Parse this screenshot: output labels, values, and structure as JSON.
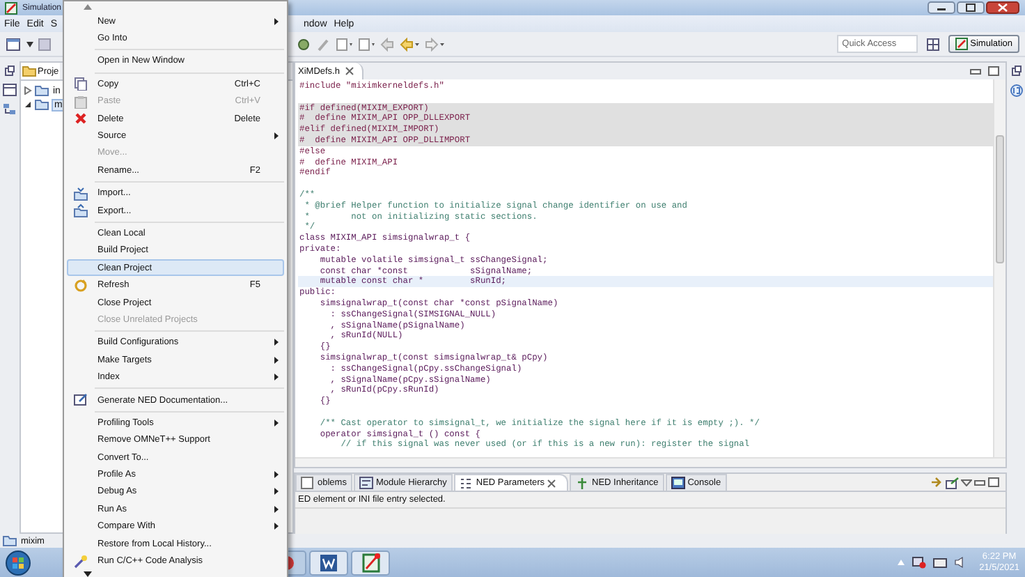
{
  "window": {
    "title": "Simulation"
  },
  "menu_bar": [
    "File",
    "Edit",
    "S",
    "ndow",
    "Help"
  ],
  "quick_access": {
    "placeholder": "Quick Access"
  },
  "perspective_button": {
    "label": "Simulation",
    "selected": true
  },
  "project_explorer": {
    "tab": "Proje",
    "items": [
      {
        "label": "in",
        "expanded": false
      },
      {
        "label": "m",
        "expanded": true
      }
    ]
  },
  "editor": {
    "tab": "XiMDefs.h",
    "lines": [
      {
        "kind": "preproc",
        "text": "#include \"miximkerneldefs.h\"",
        "shaded": false,
        "current": false
      },
      {
        "kind": "blank",
        "shaded": false,
        "current": false
      },
      {
        "kind": "preproc",
        "text": "#if defined(MIXIM_EXPORT)",
        "shaded": true,
        "current": false
      },
      {
        "kind": "preproc",
        "text": "#  define MIXIM_API OPP_DLLEXPORT",
        "shaded": true,
        "current": false
      },
      {
        "kind": "preproc",
        "text": "#elif defined(MIXIM_IMPORT)",
        "shaded": true,
        "current": false
      },
      {
        "kind": "preproc",
        "text": "#  define MIXIM_API OPP_DLLIMPORT",
        "shaded": true,
        "current": false
      },
      {
        "kind": "preproc",
        "text": "#else",
        "shaded": false,
        "current": false
      },
      {
        "kind": "preproc",
        "text": "#  define MIXIM_API",
        "shaded": false,
        "current": false
      },
      {
        "kind": "preproc",
        "text": "#endif",
        "shaded": false,
        "current": false
      },
      {
        "kind": "blank",
        "shaded": false,
        "current": false
      },
      {
        "kind": "comment",
        "text": "/**",
        "shaded": false,
        "current": false
      },
      {
        "kind": "comment",
        "text": " * @brief Helper function to initialize signal change identifier on use and",
        "shaded": false,
        "current": false
      },
      {
        "kind": "comment",
        "text": " *        not on initializing static sections.",
        "shaded": false,
        "current": false
      },
      {
        "kind": "comment",
        "text": " */",
        "shaded": false,
        "current": false
      },
      {
        "kind": "code",
        "text": "class MIXIM_API simsignalwrap_t {",
        "shaded": false,
        "current": false
      },
      {
        "kind": "code",
        "text": "private:",
        "shaded": false,
        "current": false
      },
      {
        "kind": "code",
        "text": "    mutable volatile simsignal_t ssChangeSignal;",
        "shaded": false,
        "current": false
      },
      {
        "kind": "code",
        "text": "    const char *const            sSignalName;",
        "shaded": false,
        "current": false
      },
      {
        "kind": "code",
        "text": "    mutable const char *         sRunId;",
        "shaded": false,
        "current": true
      },
      {
        "kind": "code",
        "text": "public:",
        "shaded": false,
        "current": false
      },
      {
        "kind": "code",
        "text": "    simsignalwrap_t(const char *const pSignalName)",
        "shaded": false,
        "current": false
      },
      {
        "kind": "code",
        "text": "      : ssChangeSignal(SIMSIGNAL_NULL)",
        "shaded": false,
        "current": false
      },
      {
        "kind": "code",
        "text": "      , sSignalName(pSignalName)",
        "shaded": false,
        "current": false
      },
      {
        "kind": "code",
        "text": "      , sRunId(NULL)",
        "shaded": false,
        "current": false
      },
      {
        "kind": "code",
        "text": "    {}",
        "shaded": false,
        "current": false
      },
      {
        "kind": "code",
        "text": "    simsignalwrap_t(const simsignalwrap_t& pCpy)",
        "shaded": false,
        "current": false
      },
      {
        "kind": "code",
        "text": "      : ssChangeSignal(pCpy.ssChangeSignal)",
        "shaded": false,
        "current": false
      },
      {
        "kind": "code",
        "text": "      , sSignalName(pCpy.sSignalName)",
        "shaded": false,
        "current": false
      },
      {
        "kind": "code",
        "text": "      , sRunId(pCpy.sRunId)",
        "shaded": false,
        "current": false
      },
      {
        "kind": "code",
        "text": "    {}",
        "shaded": false,
        "current": false
      },
      {
        "kind": "blank",
        "shaded": false,
        "current": false
      },
      {
        "kind": "comment",
        "text": "    /** Cast operator to simsignal_t, we initialize the signal here if it is empty ;). */",
        "shaded": false,
        "current": false
      },
      {
        "kind": "code",
        "text": "    operator simsignal_t () const {",
        "shaded": false,
        "current": false
      },
      {
        "kind": "comment",
        "text": "        // if this signal was never used (or if this is a new run): register the signal",
        "shaded": false,
        "current": false
      }
    ]
  },
  "bottom_panel": {
    "tabs": [
      {
        "label": "oblems",
        "selected": false
      },
      {
        "label": "Module Hierarchy",
        "selected": false
      },
      {
        "label": "NED Parameters",
        "selected": true
      },
      {
        "label": "NED Inheritance",
        "selected": false
      },
      {
        "label": "Console",
        "selected": false
      }
    ],
    "message": "ED element or INI file entry selected."
  },
  "status_bar": "mixim",
  "context_menu": {
    "items": [
      {
        "kind": "item",
        "label": "New",
        "submenu": true,
        "disabled": false,
        "selected": false
      },
      {
        "kind": "item",
        "label": "Go Into",
        "submenu": false,
        "disabled": false,
        "selected": false
      },
      {
        "kind": "separator"
      },
      {
        "kind": "item",
        "label": "Open in New Window",
        "submenu": false,
        "disabled": false,
        "selected": false
      },
      {
        "kind": "separator"
      },
      {
        "kind": "item",
        "label": "Copy",
        "shortcut": "Ctrl+C",
        "submenu": false,
        "disabled": false,
        "selected": false
      },
      {
        "kind": "item",
        "label": "Paste",
        "shortcut": "Ctrl+V",
        "submenu": false,
        "disabled": true,
        "selected": false
      },
      {
        "kind": "item",
        "label": "Delete",
        "shortcut": "Delete",
        "submenu": false,
        "disabled": false,
        "selected": false
      },
      {
        "kind": "item",
        "label": "Source",
        "submenu": true,
        "disabled": false,
        "selected": false
      },
      {
        "kind": "item",
        "label": "Move...",
        "submenu": false,
        "disabled": true,
        "selected": false
      },
      {
        "kind": "item",
        "label": "Rename...",
        "shortcut": "F2",
        "submenu": false,
        "disabled": false,
        "selected": false
      },
      {
        "kind": "separator"
      },
      {
        "kind": "item",
        "label": "Import...",
        "submenu": false,
        "disabled": false,
        "selected": false
      },
      {
        "kind": "item",
        "label": "Export...",
        "submenu": false,
        "disabled": false,
        "selected": false
      },
      {
        "kind": "separator"
      },
      {
        "kind": "item",
        "label": "Clean Local",
        "submenu": false,
        "disabled": false,
        "selected": false
      },
      {
        "kind": "item",
        "label": "Build Project",
        "submenu": false,
        "disabled": false,
        "selected": false
      },
      {
        "kind": "item",
        "label": "Clean Project",
        "submenu": false,
        "disabled": false,
        "selected": true
      },
      {
        "kind": "item",
        "label": "Refresh",
        "shortcut": "F5",
        "submenu": false,
        "disabled": false,
        "selected": false
      },
      {
        "kind": "item",
        "label": "Close Project",
        "submenu": false,
        "disabled": false,
        "selected": false
      },
      {
        "kind": "item",
        "label": "Close Unrelated Projects",
        "submenu": false,
        "disabled": true,
        "selected": false
      },
      {
        "kind": "separator"
      },
      {
        "kind": "item",
        "label": "Build Configurations",
        "submenu": true,
        "disabled": false,
        "selected": false
      },
      {
        "kind": "item",
        "label": "Make Targets",
        "submenu": true,
        "disabled": false,
        "selected": false
      },
      {
        "kind": "item",
        "label": "Index",
        "submenu": true,
        "disabled": false,
        "selected": false
      },
      {
        "kind": "separator"
      },
      {
        "kind": "item",
        "label": "Generate NED Documentation...",
        "submenu": false,
        "disabled": false,
        "selected": false
      },
      {
        "kind": "separator"
      },
      {
        "kind": "item",
        "label": "Profiling Tools",
        "submenu": true,
        "disabled": false,
        "selected": false
      },
      {
        "kind": "item",
        "label": "Remove OMNeT++ Support",
        "submenu": false,
        "disabled": false,
        "selected": false
      },
      {
        "kind": "item",
        "label": "Convert To...",
        "submenu": false,
        "disabled": false,
        "selected": false
      },
      {
        "kind": "item",
        "label": "Profile As",
        "submenu": true,
        "disabled": false,
        "selected": false
      },
      {
        "kind": "item",
        "label": "Debug As",
        "submenu": true,
        "disabled": false,
        "selected": false
      },
      {
        "kind": "item",
        "label": "Run As",
        "submenu": true,
        "disabled": false,
        "selected": false
      },
      {
        "kind": "item",
        "label": "Compare With",
        "submenu": true,
        "disabled": false,
        "selected": false
      },
      {
        "kind": "item",
        "label": "Restore from Local History...",
        "submenu": false,
        "disabled": false,
        "selected": false
      },
      {
        "kind": "item",
        "label": "Run C/C++ Code Analysis",
        "submenu": false,
        "disabled": false,
        "selected": false
      }
    ]
  },
  "taskbar": {
    "time": "6:22 PM",
    "date": "21/5/2021"
  }
}
